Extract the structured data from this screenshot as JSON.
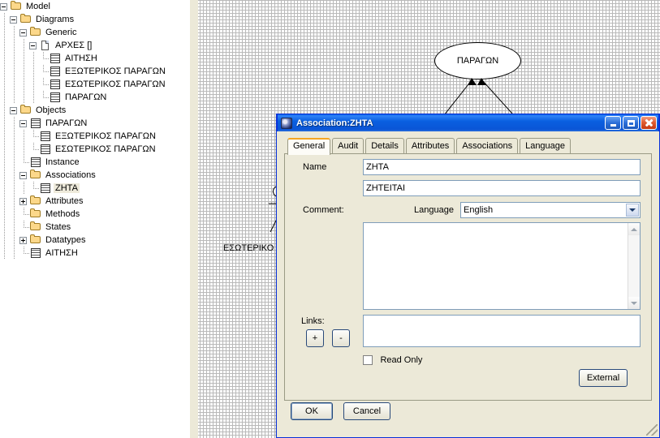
{
  "tree": {
    "name": "model-explorer",
    "items": [
      {
        "label": "Model",
        "depth": 0,
        "icon": "folder",
        "toggle": "minus"
      },
      {
        "label": "Diagrams",
        "depth": 1,
        "icon": "folder",
        "toggle": "minus"
      },
      {
        "label": "Generic",
        "depth": 2,
        "icon": "folder",
        "toggle": "minus"
      },
      {
        "label": "ΑΡΧΕΣ []",
        "depth": 3,
        "icon": "page",
        "toggle": "minus"
      },
      {
        "label": "ΑΙΤΗΣΗ",
        "depth": 4,
        "icon": "table",
        "toggle": "none"
      },
      {
        "label": "ΕΞΩΤΕΡΙΚΟΣ ΠΑΡΑΓΩΝ",
        "depth": 4,
        "icon": "table",
        "toggle": "none"
      },
      {
        "label": "ΕΣΩΤΕΡΙΚΟΣ ΠΑΡΑΓΩΝ",
        "depth": 4,
        "icon": "table",
        "toggle": "none"
      },
      {
        "label": "ΠΑΡΑΓΩΝ",
        "depth": 4,
        "icon": "table",
        "toggle": "none"
      },
      {
        "label": "Objects",
        "depth": 1,
        "icon": "folder",
        "toggle": "minus"
      },
      {
        "label": "ΠΑΡΑΓΩΝ",
        "depth": 2,
        "icon": "table",
        "toggle": "minus"
      },
      {
        "label": "ΕΞΩΤΕΡΙΚΟΣ ΠΑΡΑΓΩΝ",
        "depth": 3,
        "icon": "table",
        "toggle": "none"
      },
      {
        "label": "ΕΣΩΤΕΡΙΚΟΣ ΠΑΡΑΓΩΝ",
        "depth": 3,
        "icon": "table",
        "toggle": "none"
      },
      {
        "label": "Instance",
        "depth": 2,
        "icon": "table",
        "toggle": "none"
      },
      {
        "label": "Associations",
        "depth": 2,
        "icon": "folder",
        "toggle": "minus"
      },
      {
        "label": "ZHTA",
        "depth": 3,
        "icon": "table",
        "toggle": "none",
        "selected": true
      },
      {
        "label": "Attributes",
        "depth": 2,
        "icon": "folder",
        "toggle": "plus"
      },
      {
        "label": "Methods",
        "depth": 2,
        "icon": "folder",
        "toggle": "none"
      },
      {
        "label": "States",
        "depth": 2,
        "icon": "folder",
        "toggle": "none"
      },
      {
        "label": "Datatypes",
        "depth": 2,
        "icon": "folder",
        "toggle": "plus"
      },
      {
        "label": "ΑΙΤΗΣΗ",
        "depth": 2,
        "icon": "table",
        "toggle": "none"
      }
    ]
  },
  "diagram": {
    "nodes": [
      {
        "label": "ΠΑΡΑΓΩΝ",
        "type": "use-case-oval"
      }
    ],
    "labels": [
      {
        "text": "ΕΣΩΤΕΡΙΚΟ"
      }
    ],
    "actor_name": "actor-stick-figure"
  },
  "dialog": {
    "title": "Association:ZHTA",
    "icon": "app-icon",
    "window_buttons": {
      "minimize": "minimize-button",
      "maximize": "maximize-button",
      "close": "close-button"
    },
    "tabs": [
      {
        "label": "General",
        "active": true
      },
      {
        "label": "Audit",
        "active": false
      },
      {
        "label": "Details",
        "active": false
      },
      {
        "label": "Attributes",
        "active": false
      },
      {
        "label": "Associations",
        "active": false
      },
      {
        "label": "Language",
        "active": false
      }
    ],
    "general": {
      "name_label": "Name",
      "name_value": "ZHTA",
      "alias_value": "ZHTEITAI",
      "comment_label": "Comment:",
      "language_label": "Language",
      "language_value": "English",
      "comment_value": "",
      "links_label": "Links:",
      "links_add_label": "+",
      "links_remove_label": "-",
      "links_value": "",
      "read_only_label": "Read Only",
      "read_only_checked": false,
      "external_label": "External"
    },
    "footer": {
      "ok_label": "OK",
      "cancel_label": "Cancel"
    }
  },
  "colors": {
    "titlebar_blue": "#0a55d6",
    "dialog_face": "#ece9d8",
    "tab_active_accent": "#f5a623",
    "selection_highlight": "#eeeadb",
    "field_border": "#7f9db9",
    "grid_line": "#b9b9b9"
  }
}
